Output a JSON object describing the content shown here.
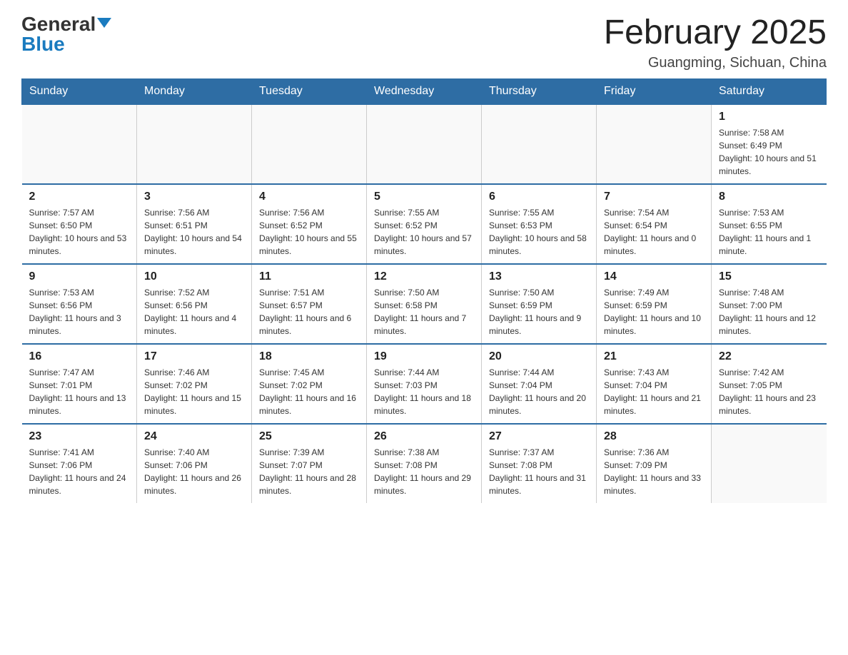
{
  "header": {
    "logo_general": "General",
    "logo_blue": "Blue",
    "title": "February 2025",
    "subtitle": "Guangming, Sichuan, China"
  },
  "days_of_week": [
    "Sunday",
    "Monday",
    "Tuesday",
    "Wednesday",
    "Thursday",
    "Friday",
    "Saturday"
  ],
  "weeks": [
    {
      "days": [
        {
          "num": "",
          "sunrise": "",
          "sunset": "",
          "daylight": "",
          "empty": true
        },
        {
          "num": "",
          "sunrise": "",
          "sunset": "",
          "daylight": "",
          "empty": true
        },
        {
          "num": "",
          "sunrise": "",
          "sunset": "",
          "daylight": "",
          "empty": true
        },
        {
          "num": "",
          "sunrise": "",
          "sunset": "",
          "daylight": "",
          "empty": true
        },
        {
          "num": "",
          "sunrise": "",
          "sunset": "",
          "daylight": "",
          "empty": true
        },
        {
          "num": "",
          "sunrise": "",
          "sunset": "",
          "daylight": "",
          "empty": true
        },
        {
          "num": "1",
          "sunrise": "Sunrise: 7:58 AM",
          "sunset": "Sunset: 6:49 PM",
          "daylight": "Daylight: 10 hours and 51 minutes.",
          "empty": false
        }
      ]
    },
    {
      "days": [
        {
          "num": "2",
          "sunrise": "Sunrise: 7:57 AM",
          "sunset": "Sunset: 6:50 PM",
          "daylight": "Daylight: 10 hours and 53 minutes.",
          "empty": false
        },
        {
          "num": "3",
          "sunrise": "Sunrise: 7:56 AM",
          "sunset": "Sunset: 6:51 PM",
          "daylight": "Daylight: 10 hours and 54 minutes.",
          "empty": false
        },
        {
          "num": "4",
          "sunrise": "Sunrise: 7:56 AM",
          "sunset": "Sunset: 6:52 PM",
          "daylight": "Daylight: 10 hours and 55 minutes.",
          "empty": false
        },
        {
          "num": "5",
          "sunrise": "Sunrise: 7:55 AM",
          "sunset": "Sunset: 6:52 PM",
          "daylight": "Daylight: 10 hours and 57 minutes.",
          "empty": false
        },
        {
          "num": "6",
          "sunrise": "Sunrise: 7:55 AM",
          "sunset": "Sunset: 6:53 PM",
          "daylight": "Daylight: 10 hours and 58 minutes.",
          "empty": false
        },
        {
          "num": "7",
          "sunrise": "Sunrise: 7:54 AM",
          "sunset": "Sunset: 6:54 PM",
          "daylight": "Daylight: 11 hours and 0 minutes.",
          "empty": false
        },
        {
          "num": "8",
          "sunrise": "Sunrise: 7:53 AM",
          "sunset": "Sunset: 6:55 PM",
          "daylight": "Daylight: 11 hours and 1 minute.",
          "empty": false
        }
      ]
    },
    {
      "days": [
        {
          "num": "9",
          "sunrise": "Sunrise: 7:53 AM",
          "sunset": "Sunset: 6:56 PM",
          "daylight": "Daylight: 11 hours and 3 minutes.",
          "empty": false
        },
        {
          "num": "10",
          "sunrise": "Sunrise: 7:52 AM",
          "sunset": "Sunset: 6:56 PM",
          "daylight": "Daylight: 11 hours and 4 minutes.",
          "empty": false
        },
        {
          "num": "11",
          "sunrise": "Sunrise: 7:51 AM",
          "sunset": "Sunset: 6:57 PM",
          "daylight": "Daylight: 11 hours and 6 minutes.",
          "empty": false
        },
        {
          "num": "12",
          "sunrise": "Sunrise: 7:50 AM",
          "sunset": "Sunset: 6:58 PM",
          "daylight": "Daylight: 11 hours and 7 minutes.",
          "empty": false
        },
        {
          "num": "13",
          "sunrise": "Sunrise: 7:50 AM",
          "sunset": "Sunset: 6:59 PM",
          "daylight": "Daylight: 11 hours and 9 minutes.",
          "empty": false
        },
        {
          "num": "14",
          "sunrise": "Sunrise: 7:49 AM",
          "sunset": "Sunset: 6:59 PM",
          "daylight": "Daylight: 11 hours and 10 minutes.",
          "empty": false
        },
        {
          "num": "15",
          "sunrise": "Sunrise: 7:48 AM",
          "sunset": "Sunset: 7:00 PM",
          "daylight": "Daylight: 11 hours and 12 minutes.",
          "empty": false
        }
      ]
    },
    {
      "days": [
        {
          "num": "16",
          "sunrise": "Sunrise: 7:47 AM",
          "sunset": "Sunset: 7:01 PM",
          "daylight": "Daylight: 11 hours and 13 minutes.",
          "empty": false
        },
        {
          "num": "17",
          "sunrise": "Sunrise: 7:46 AM",
          "sunset": "Sunset: 7:02 PM",
          "daylight": "Daylight: 11 hours and 15 minutes.",
          "empty": false
        },
        {
          "num": "18",
          "sunrise": "Sunrise: 7:45 AM",
          "sunset": "Sunset: 7:02 PM",
          "daylight": "Daylight: 11 hours and 16 minutes.",
          "empty": false
        },
        {
          "num": "19",
          "sunrise": "Sunrise: 7:44 AM",
          "sunset": "Sunset: 7:03 PM",
          "daylight": "Daylight: 11 hours and 18 minutes.",
          "empty": false
        },
        {
          "num": "20",
          "sunrise": "Sunrise: 7:44 AM",
          "sunset": "Sunset: 7:04 PM",
          "daylight": "Daylight: 11 hours and 20 minutes.",
          "empty": false
        },
        {
          "num": "21",
          "sunrise": "Sunrise: 7:43 AM",
          "sunset": "Sunset: 7:04 PM",
          "daylight": "Daylight: 11 hours and 21 minutes.",
          "empty": false
        },
        {
          "num": "22",
          "sunrise": "Sunrise: 7:42 AM",
          "sunset": "Sunset: 7:05 PM",
          "daylight": "Daylight: 11 hours and 23 minutes.",
          "empty": false
        }
      ]
    },
    {
      "days": [
        {
          "num": "23",
          "sunrise": "Sunrise: 7:41 AM",
          "sunset": "Sunset: 7:06 PM",
          "daylight": "Daylight: 11 hours and 24 minutes.",
          "empty": false
        },
        {
          "num": "24",
          "sunrise": "Sunrise: 7:40 AM",
          "sunset": "Sunset: 7:06 PM",
          "daylight": "Daylight: 11 hours and 26 minutes.",
          "empty": false
        },
        {
          "num": "25",
          "sunrise": "Sunrise: 7:39 AM",
          "sunset": "Sunset: 7:07 PM",
          "daylight": "Daylight: 11 hours and 28 minutes.",
          "empty": false
        },
        {
          "num": "26",
          "sunrise": "Sunrise: 7:38 AM",
          "sunset": "Sunset: 7:08 PM",
          "daylight": "Daylight: 11 hours and 29 minutes.",
          "empty": false
        },
        {
          "num": "27",
          "sunrise": "Sunrise: 7:37 AM",
          "sunset": "Sunset: 7:08 PM",
          "daylight": "Daylight: 11 hours and 31 minutes.",
          "empty": false
        },
        {
          "num": "28",
          "sunrise": "Sunrise: 7:36 AM",
          "sunset": "Sunset: 7:09 PM",
          "daylight": "Daylight: 11 hours and 33 minutes.",
          "empty": false
        },
        {
          "num": "",
          "sunrise": "",
          "sunset": "",
          "daylight": "",
          "empty": true
        }
      ]
    }
  ]
}
